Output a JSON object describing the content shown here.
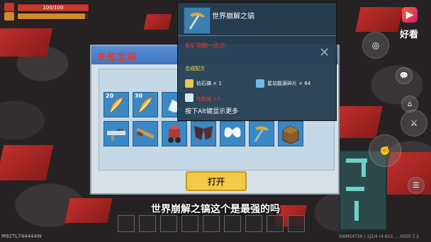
{
  "hud": {
    "health_text": "100/100",
    "health_fraction": 1.0,
    "hunger_fraction": 0.95
  },
  "chest": {
    "title": "未知宝箱",
    "open_label": "打开",
    "row1": [
      {
        "icon": "feather-icon",
        "count": "20",
        "color": "#e7b85d"
      },
      {
        "icon": "feather-icon",
        "count": "30",
        "color": "#e6b45a"
      },
      {
        "icon": "crystal-icon",
        "count": "",
        "color": "#dff2ff"
      }
    ],
    "row2": [
      {
        "icon": "rifle-icon",
        "count": "",
        "color": "#d9dde1"
      },
      {
        "icon": "shotgun-icon",
        "count": "",
        "color": "#c79a5a"
      },
      {
        "icon": "mech-icon",
        "count": "",
        "color": "#b03a2f"
      },
      {
        "icon": "dark-wings-icon",
        "count": "",
        "color": "#4a2b2b"
      },
      {
        "icon": "white-wings-icon",
        "count": "",
        "color": "#f1f1f1"
      },
      {
        "icon": "pickaxe-icon",
        "count": "",
        "color": "#e0a830"
      },
      {
        "icon": "crate-icon",
        "count": "",
        "color": "#8a5a2a"
      }
    ]
  },
  "tooltip": {
    "item_name": "世界崩解之镐",
    "desc": "能矿物翻一倍点!",
    "recipe_title": "合成配方",
    "materials": [
      {
        "icon": "gold-key-icon",
        "label": "钻石镐 × 1"
      },
      {
        "icon": "shard-icon",
        "label": "星站能源碎片 × 64"
      }
    ],
    "red_line": "充能值 +3",
    "more": "按下Alt键显示更多"
  },
  "subtitle": "世界崩解之镐这个是最强的吗",
  "watermark": {
    "brand": "好看",
    "left_code": "M92TL744444W",
    "right_code": "5I6M54756 | 1J2/4 (4.6)/1 ... 0020 7.2"
  },
  "colors": {
    "lava": "#c9302b",
    "slot": "#3c88c4",
    "panel_header": "#4a80cc",
    "button": "#f3c94b"
  }
}
